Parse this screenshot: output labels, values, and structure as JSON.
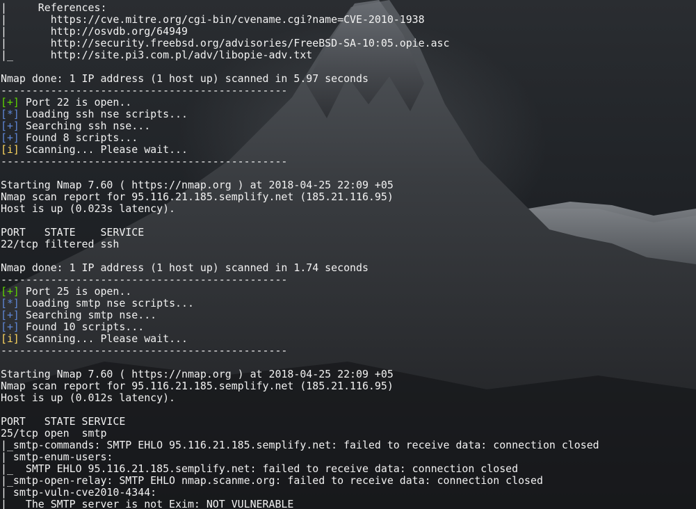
{
  "terminal": {
    "lines": [
      {
        "text": "|     References:"
      },
      {
        "text": "|       https://cve.mitre.org/cgi-bin/cvename.cgi?name=CVE-2010-1938"
      },
      {
        "text": "|       http://osvdb.org/64949"
      },
      {
        "text": "|       http://security.freebsd.org/advisories/FreeBSD-SA-10:05.opie.asc"
      },
      {
        "text": "|_      http://site.pi3.com.pl/adv/libopie-adv.txt"
      },
      {
        "text": ""
      },
      {
        "text": "Nmap done: 1 IP address (1 host up) scanned in 5.97 seconds"
      },
      {
        "text": "----------------------------------------------"
      },
      {
        "tag": "[+]",
        "tag_color": "plus",
        "text": " Port 22 is open.."
      },
      {
        "tag": "[*]",
        "tag_color": "star",
        "text": " Loading ssh nse scripts..."
      },
      {
        "tag": "[+]",
        "tag_color": "blue",
        "text": " Searching ssh nse..."
      },
      {
        "tag": "[+]",
        "tag_color": "blue",
        "text": " Found 8 scripts..."
      },
      {
        "tag": "[i]",
        "tag_color": "info",
        "text": " Scanning... Please wait..."
      },
      {
        "text": "----------------------------------------------"
      },
      {
        "text": ""
      },
      {
        "text": "Starting Nmap 7.60 ( https://nmap.org ) at 2018-04-25 22:09 +05"
      },
      {
        "text": "Nmap scan report for 95.116.21.185.semplify.net (185.21.116.95)"
      },
      {
        "text": "Host is up (0.023s latency)."
      },
      {
        "text": ""
      },
      {
        "text": "PORT   STATE    SERVICE"
      },
      {
        "text": "22/tcp filtered ssh"
      },
      {
        "text": ""
      },
      {
        "text": "Nmap done: 1 IP address (1 host up) scanned in 1.74 seconds"
      },
      {
        "text": "----------------------------------------------"
      },
      {
        "tag": "[+]",
        "tag_color": "plus",
        "text": " Port 25 is open.."
      },
      {
        "tag": "[*]",
        "tag_color": "star",
        "text": " Loading smtp nse scripts..."
      },
      {
        "tag": "[+]",
        "tag_color": "blue",
        "text": " Searching smtp nse..."
      },
      {
        "tag": "[+]",
        "tag_color": "blue",
        "text": " Found 10 scripts..."
      },
      {
        "tag": "[i]",
        "tag_color": "info",
        "text": " Scanning... Please wait..."
      },
      {
        "text": "----------------------------------------------"
      },
      {
        "text": ""
      },
      {
        "text": "Starting Nmap 7.60 ( https://nmap.org ) at 2018-04-25 22:09 +05"
      },
      {
        "text": "Nmap scan report for 95.116.21.185.semplify.net (185.21.116.95)"
      },
      {
        "text": "Host is up (0.012s latency)."
      },
      {
        "text": ""
      },
      {
        "text": "PORT   STATE SERVICE"
      },
      {
        "text": "25/tcp open  smtp"
      },
      {
        "text": "|_smtp-commands: SMTP EHLO 95.116.21.185.semplify.net: failed to receive data: connection closed"
      },
      {
        "text": "| smtp-enum-users:"
      },
      {
        "text": "|_  SMTP EHLO 95.116.21.185.semplify.net: failed to receive data: connection closed"
      },
      {
        "text": "|_smtp-open-relay: SMTP EHLO nmap.scanme.org: failed to receive data: connection closed"
      },
      {
        "text": "| smtp-vuln-cve2010-4344:"
      },
      {
        "text": "|   The SMTP server is not Exim: NOT VULNERABLE"
      }
    ]
  },
  "colors": {
    "text": "#f2f2f2",
    "plus": "#5fd700",
    "star": "#5f87d7",
    "blue": "#5f87d7",
    "info": "#ffd75f"
  }
}
